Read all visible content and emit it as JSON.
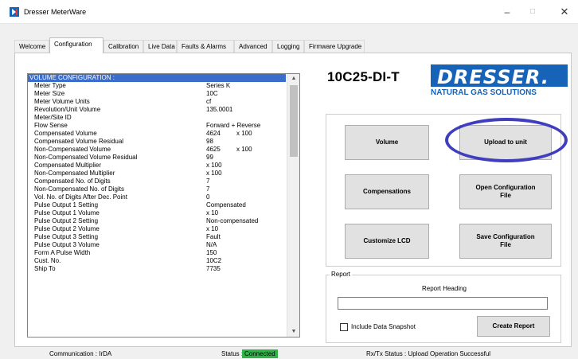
{
  "window": {
    "title": "Dresser MeterWare",
    "minimize": "–",
    "maximize": "□",
    "close": "✕",
    "icon": "app-logo-icon"
  },
  "tabs": [
    "Welcome",
    "Configuration",
    "Calibration",
    "Live Data",
    "Faults & Alarms",
    "Advanced",
    "Logging",
    "Firmware Upgrade"
  ],
  "active_tab": "Configuration",
  "config": {
    "header": "VOLUME CONFIGURATION :",
    "rows": [
      {
        "label": "Meter Type",
        "value": "Series K",
        "extra": ""
      },
      {
        "label": "Meter Size",
        "value": "10C",
        "extra": ""
      },
      {
        "label": "Meter Volume Units",
        "value": "cf",
        "extra": ""
      },
      {
        "label": "Revolution/Unit Volume",
        "value": "135.0001",
        "extra": ""
      },
      {
        "label": "Meter/Site ID",
        "value": "",
        "extra": ""
      },
      {
        "label": "Flow Sense",
        "value": "Forward + Reverse",
        "extra": ""
      },
      {
        "label": "Compensated Volume",
        "value": "4624",
        "extra": "x 100"
      },
      {
        "label": "Compensated Volume Residual",
        "value": "98",
        "extra": ""
      },
      {
        "label": "Non-Compensated Volume",
        "value": "4625",
        "extra": "x 100"
      },
      {
        "label": "Non-Compensated Volume Residual",
        "value": "99",
        "extra": ""
      },
      {
        "label": "Compensated Multiplier",
        "value": "x 100",
        "extra": ""
      },
      {
        "label": "Non-Compensated Multiplier",
        "value": "x 100",
        "extra": ""
      },
      {
        "label": "Compensated No. of Digits",
        "value": "7",
        "extra": ""
      },
      {
        "label": "Non-Compensated No. of Digits",
        "value": "7",
        "extra": ""
      },
      {
        "label": "Vol. No. of Digits After Dec. Point",
        "value": "0",
        "extra": ""
      },
      {
        "label": "Pulse Output 1 Setting",
        "value": "Compensated",
        "extra": ""
      },
      {
        "label": "Pulse Output 1 Volume",
        "value": "x 10",
        "extra": ""
      },
      {
        "label": "Pulse Output 2 Setting",
        "value": "Non-compensated",
        "extra": ""
      },
      {
        "label": "Pulse Output 2 Volume",
        "value": "x 10",
        "extra": ""
      },
      {
        "label": "Pulse Output 3 Setting",
        "value": "Fault",
        "extra": ""
      },
      {
        "label": "Pulse Output 3 Volume",
        "value": "N/A",
        "extra": ""
      },
      {
        "label": "Form A Pulse Width",
        "value": "150",
        "extra": ""
      },
      {
        "label": "Cust. No.",
        "value": "10C2",
        "extra": ""
      },
      {
        "label": "Ship To",
        "value": "7735",
        "extra": ""
      }
    ],
    "scroll_up": "▲",
    "scroll_down": "▼"
  },
  "model": "10C25-DI-T",
  "logo": {
    "brand": "DRESSER.",
    "subtitle": "NATURAL GAS SOLUTIONS"
  },
  "buttons": {
    "volume": "Volume",
    "upload": "Upload to unit",
    "compensations": "Compensations",
    "open_config": "Open Configuration File",
    "customize_lcd": "Customize LCD",
    "save_config": "Save Configuration File",
    "create_report": "Create Report"
  },
  "report": {
    "title": "Report",
    "heading_label": "Report Heading",
    "heading_value": "",
    "include_snapshot_label": "Include Data Snapshot",
    "include_snapshot_checked": false
  },
  "statusbar": {
    "communication": "Communication : IrDA",
    "status_label": "Status :",
    "status_value": "Connected",
    "status_color": "#2fb44a",
    "rxtx": "Rx/Tx Status : Upload Operation Successful"
  },
  "colors": {
    "accent_ring": "#3e3ebf",
    "header_blue": "#3b6ecb",
    "brand_blue": "#1763b8"
  }
}
